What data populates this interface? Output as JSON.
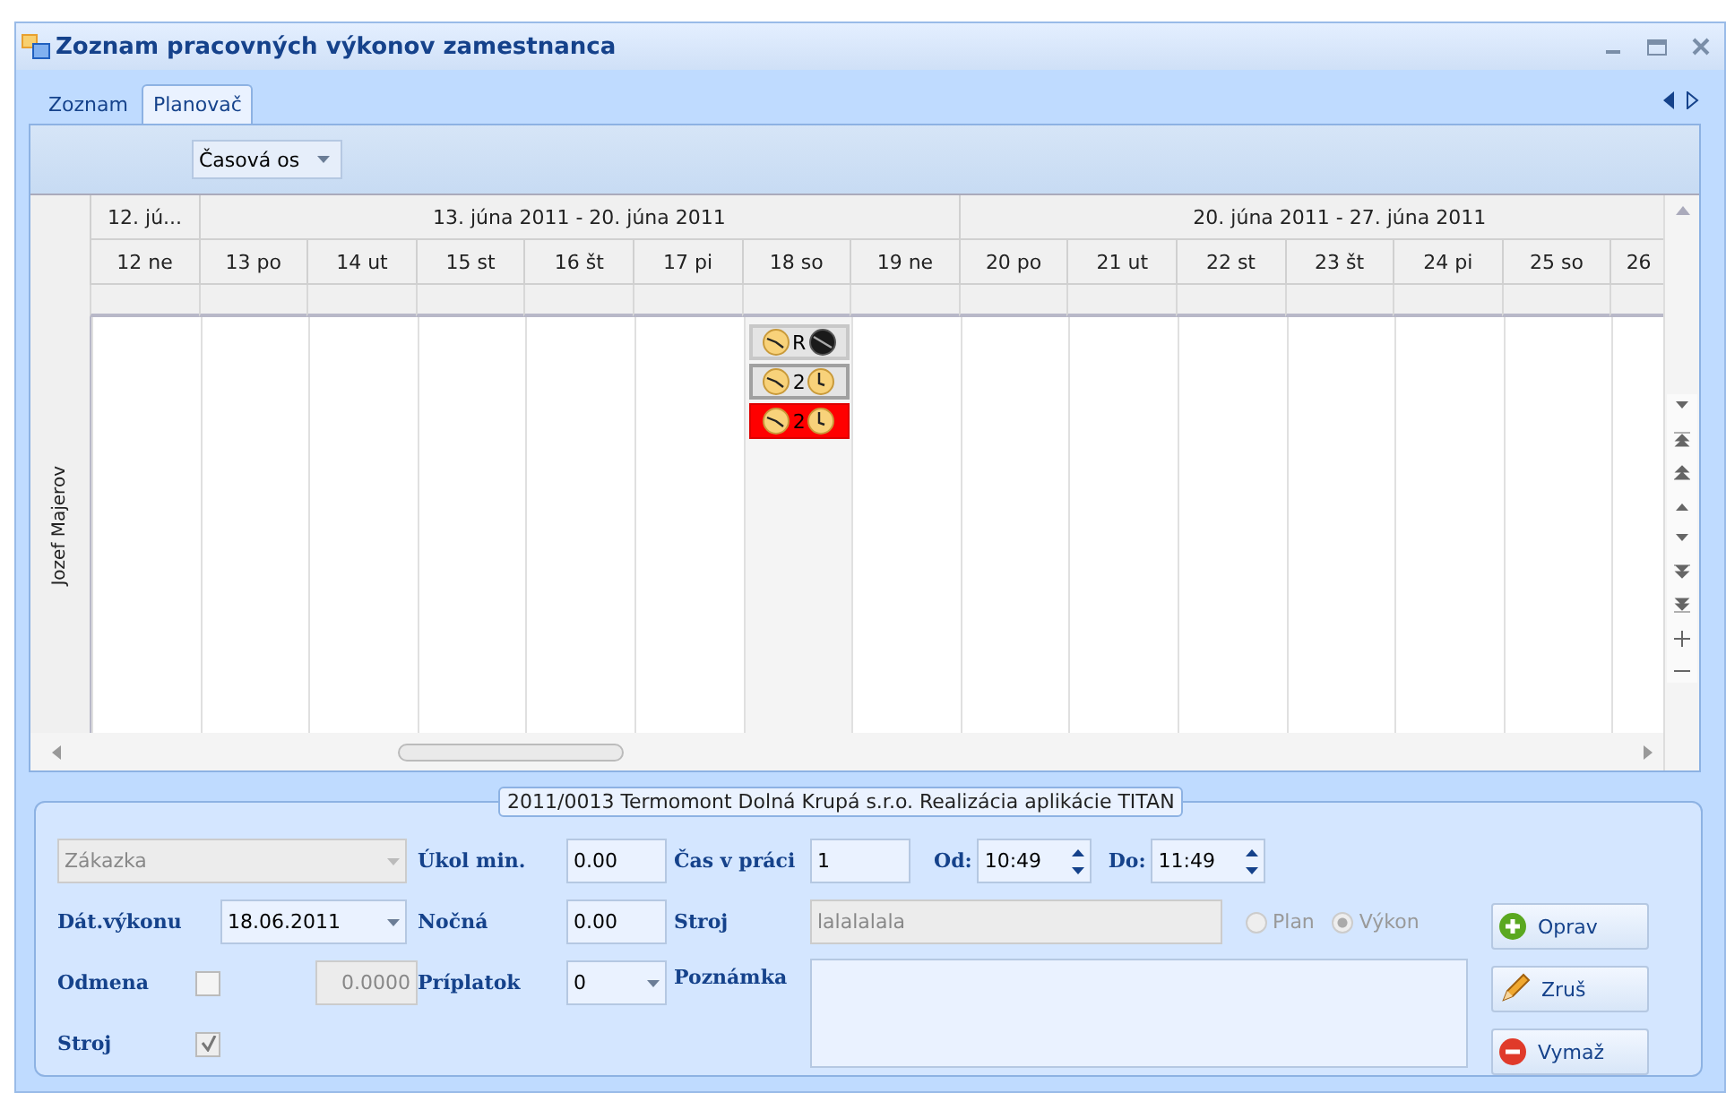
{
  "window": {
    "title": "Zoznam pracovných výkonov zamestnanca"
  },
  "tabs": [
    {
      "label": "Zoznam",
      "selected": false
    },
    {
      "label": "Planovač",
      "selected": true
    }
  ],
  "toolbar": {
    "view": "Časová os"
  },
  "scheduler": {
    "resource": "Jozef Majerov",
    "groups": [
      {
        "label": "12. jú...",
        "days": [
          {
            "label": "12 ne"
          }
        ]
      },
      {
        "label": "13. júna 2011 - 20. júna 2011",
        "days": [
          {
            "label": "13 po"
          },
          {
            "label": "14 ut"
          },
          {
            "label": "15 st"
          },
          {
            "label": "16 št"
          },
          {
            "label": "17 pi"
          },
          {
            "label": "18 so",
            "events": [
              {
                "label": "R",
                "kind": "dark"
              },
              {
                "label": "2",
                "kind": "normal"
              },
              {
                "label": "2",
                "kind": "alert"
              }
            ]
          },
          {
            "label": "19 ne"
          }
        ]
      },
      {
        "label": "20. júna 2011 - 27. júna 2011",
        "days": [
          {
            "label": "20 po"
          },
          {
            "label": "21 ut"
          },
          {
            "label": "22 st"
          },
          {
            "label": "23 št"
          },
          {
            "label": "24 pi"
          },
          {
            "label": "25 so"
          },
          {
            "label": "26"
          }
        ]
      }
    ]
  },
  "details": {
    "title": "2011/0013 Termomont Dolná Krupá s.r.o. Realizácia aplikácie TITAN",
    "order": {
      "value": "Zákazka",
      "disabled": true
    },
    "date": {
      "label": "Dát.výkonu",
      "value": "18.06.2011"
    },
    "bonus": {
      "label": "Odmena",
      "checked": false,
      "value": "0.0000"
    },
    "machine_check": {
      "label": "Stroj",
      "checked": true
    },
    "task": {
      "label": "Úkol min.",
      "value": "0.00"
    },
    "night": {
      "label": "Nočná",
      "value": "0.00"
    },
    "surcharge": {
      "label": "Príplatok",
      "value": "0"
    },
    "work_time": {
      "label": "Čas v práci",
      "value": "1"
    },
    "from": {
      "label": "Od:",
      "value": "10:49"
    },
    "to": {
      "label": "Do:",
      "value": "11:49"
    },
    "machine": {
      "label": "Stroj",
      "value": "lalalalala"
    },
    "note": {
      "label": "Poznámka"
    },
    "modes": [
      {
        "label": "Plan",
        "selected": false
      },
      {
        "label": "Výkon",
        "selected": true
      }
    ],
    "buttons": [
      {
        "label": "Oprav",
        "kind": "add"
      },
      {
        "label": "Zruš",
        "kind": "edit"
      },
      {
        "label": "Vymaž",
        "kind": "delete"
      }
    ]
  }
}
